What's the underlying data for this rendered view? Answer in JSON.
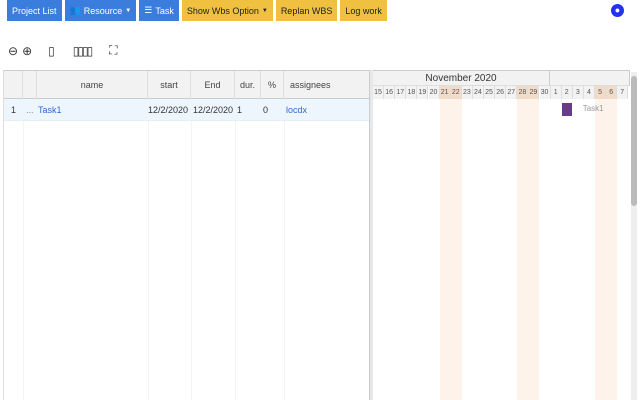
{
  "toolbar": {
    "project_list": "Project List",
    "resource": "Resource",
    "task": "Task",
    "show_wbs": "Show Wbs Option",
    "replan": "Replan WBS",
    "log_work": "Log work"
  },
  "grid": {
    "headers": {
      "name": "name",
      "start": "start",
      "end": "End",
      "dur": "dur.",
      "pct": "%",
      "assignees": "assignees"
    },
    "rows": [
      {
        "num": "1",
        "dots": "...",
        "name": "Task1",
        "start": "12/2/2020",
        "end": "12/2/2020",
        "dur": "1",
        "pct": "0",
        "assignees": "locdx"
      }
    ]
  },
  "gantt": {
    "month": "November 2020",
    "days": [
      "15",
      "16",
      "17",
      "18",
      "19",
      "20",
      "21",
      "22",
      "23",
      "24",
      "25",
      "26",
      "27",
      "28",
      "29",
      "30",
      "1",
      "2",
      "3",
      "4",
      "5",
      "6",
      "7"
    ],
    "weekends": [
      "21",
      "22",
      "28",
      "29",
      "5",
      "6"
    ],
    "bar_label": "Task1",
    "bar_color": "#6a3a8c"
  }
}
